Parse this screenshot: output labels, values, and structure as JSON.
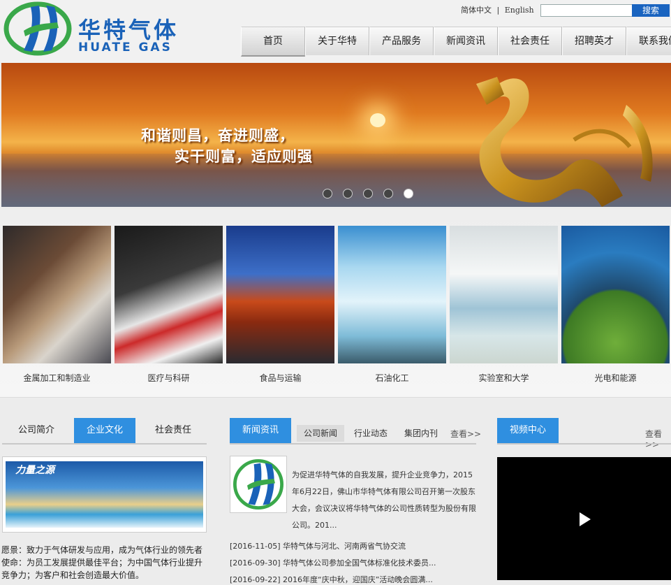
{
  "header": {
    "brand_cn": "华特气体",
    "brand_en": "HUATE GAS",
    "lang_cn": "简体中文",
    "lang_sep": "|",
    "lang_en": "English",
    "search_placeholder": "",
    "search_label": "搜索"
  },
  "nav": [
    "首页",
    "关于华特",
    "产品服务",
    "新闻资讯",
    "社会责任",
    "招聘英才",
    "联系我们"
  ],
  "banner": {
    "slogan_line1": "和谐则昌，奋进则盛，",
    "slogan_line2": "实干则富，适应则强",
    "slide_count": 5,
    "active_slide": 5
  },
  "categories": [
    "金属加工和制造业",
    "医疗与科研",
    "食品与运输",
    "石油化工",
    "实验室和大学",
    "光电和能源"
  ],
  "about": {
    "tabs": [
      "公司简介",
      "企业文化",
      "社会责任"
    ],
    "active_tab": 1,
    "image_caption": "力量之源",
    "text": "愿景：致力于气体研发与应用，成为气体行业的领先者使命：为员工发展提供最佳平台；为中国气体行业提升竞争力；为客户和社会创造最大价值。"
  },
  "news": {
    "title": "新闻资讯",
    "tabs": [
      "公司新闻",
      "行业动态",
      "集团内刊"
    ],
    "more": "查看>>",
    "lead": "为促进华特气体的自我发展，提升企业竞争力，2015年6月22日，佛山市华特气体有限公司召开第一次股东大会，会议决议将华特气体的公司性质转型为股份有限公司。201...",
    "items": [
      {
        "date": "[2016-11-05]",
        "title": "华特气体与河北、河南两省气协交流"
      },
      {
        "date": "[2016-09-30]",
        "title": "华特气体公司参加全国气体标准化技术委员..."
      },
      {
        "date": "[2016-09-22]",
        "title": "2016年度“庆中秋，迎国庆”活动晚会圆满..."
      }
    ]
  },
  "video": {
    "title": "视频中心",
    "more": "查看>>"
  },
  "colors": {
    "brand_blue": "#1a62b8",
    "tab_blue": "#2f8fe0",
    "logo_green": "#3aa84a"
  }
}
